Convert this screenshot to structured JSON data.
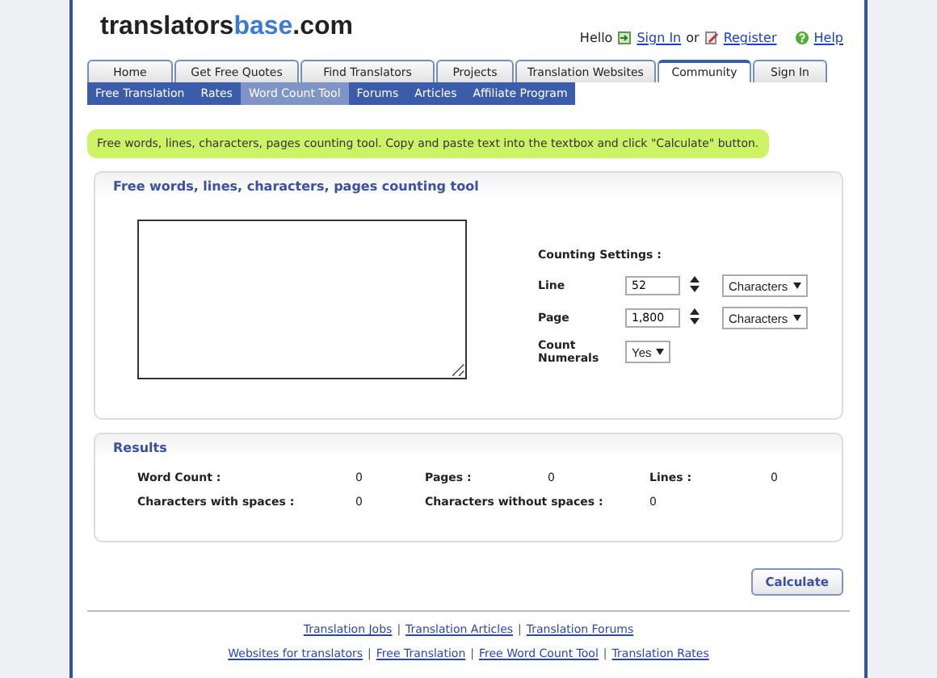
{
  "logo": [
    {
      "text": "translators",
      "kind": "plain"
    },
    {
      "text": "base",
      "kind": "accent"
    },
    {
      "text": ".com",
      "kind": "plain"
    }
  ],
  "user_bar": {
    "greeting": "Hello",
    "links": [
      "Sign In",
      "Register"
    ],
    "separator": "or",
    "help": "Help"
  },
  "tabs": [
    {
      "label": "Home",
      "selected": false
    },
    {
      "label": "Get Free Quotes",
      "selected": false
    },
    {
      "label": "Find Translators",
      "selected": false
    },
    {
      "label": "Projects",
      "selected": false
    },
    {
      "label": "Translation Websites",
      "selected": false
    },
    {
      "label": "Community",
      "selected": true
    },
    {
      "label": "Sign In",
      "selected": false
    }
  ],
  "subnav": [
    {
      "label": "Free Translation",
      "selected": false
    },
    {
      "label": "Rates",
      "selected": false
    },
    {
      "label": "Word Count Tool",
      "selected": true
    },
    {
      "label": "Forums",
      "selected": false
    },
    {
      "label": "Articles",
      "selected": false
    },
    {
      "label": "Affiliate Program",
      "selected": false
    }
  ],
  "notice": "Free words, lines, characters, pages counting tool. Copy and paste text into the textbox and click \"Calculate\" button.",
  "tool_panel": {
    "title": "Free words, lines, characters, pages counting tool",
    "settings_title": "Counting Settings :",
    "settings": [
      {
        "label": "Line",
        "kind": "spinner",
        "value": "52",
        "unit": "Characters"
      },
      {
        "label": "Page",
        "kind": "spinner",
        "value": "1,800",
        "unit": "Characters"
      },
      {
        "label": "Count Numerals",
        "kind": "select",
        "value": "Yes"
      }
    ]
  },
  "results": {
    "title": "Results",
    "rows": [
      [
        {
          "label": "Word Count :",
          "value": "0"
        },
        {
          "label": "Pages :",
          "value": "0"
        },
        {
          "label": "Lines :",
          "value": "0"
        }
      ],
      [
        {
          "label": "Characters with spaces :",
          "value": "0"
        },
        {
          "label": "Characters without spaces :",
          "value": "0"
        }
      ]
    ]
  },
  "calculate_button": "Calculate",
  "footer": {
    "separator": "|",
    "rows": [
      [
        "Translation Jobs",
        "Translation Articles",
        "Translation Forums"
      ],
      [
        "Websites for translators",
        "Free Translation",
        "Free Word Count Tool",
        "Translation Rates"
      ]
    ]
  }
}
